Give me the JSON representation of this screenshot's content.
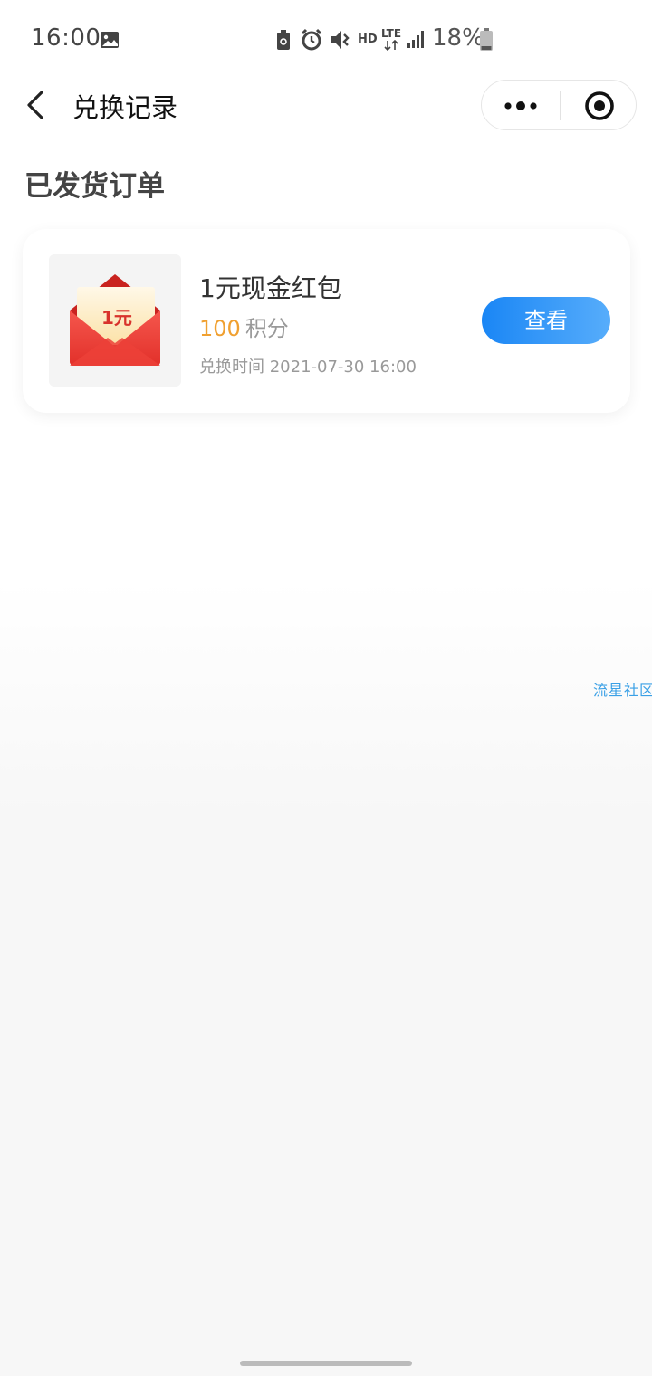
{
  "status_bar": {
    "time": "16:00",
    "network_label": "HD",
    "lte_label": "LTE",
    "battery": "18%",
    "icons": [
      "image-icon",
      "battery-saver-icon",
      "alarm-icon",
      "vibrate-icon",
      "hd-icon",
      "lte-icon",
      "signal-icon",
      "battery-icon"
    ]
  },
  "nav": {
    "title": "兑换记录"
  },
  "section": {
    "title": "已发货订单"
  },
  "orders": [
    {
      "name": "1元现金红包",
      "thumb_label": "1元",
      "points": "100",
      "points_unit": "积分",
      "exchange_time": "兑换时间 2021-07-30 16:00",
      "action_label": "查看"
    }
  ],
  "watermark": "流星社区",
  "colors": {
    "accent_blue": "#1a86f5",
    "points_orange": "#f0a030",
    "envelope_red": "#e8352f"
  }
}
